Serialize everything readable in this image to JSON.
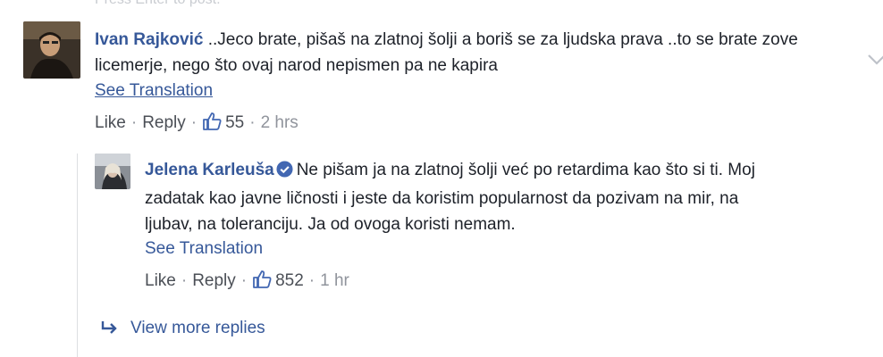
{
  "top_hint": "Press Enter to post.",
  "comments": [
    {
      "author": "Ivan Rajković",
      "text": "..Jeco brate, pišaš na zlatnoj šolji a boriš se za ljudska prava ..to se brate zove licemerje, nego što ovaj narod nepismen pa ne kapira",
      "see_translation": "See Translation",
      "like_label": "Like",
      "reply_label": "Reply",
      "like_count": "55",
      "time": "2 hrs"
    },
    {
      "author": "Jelena Karleuša",
      "verified": true,
      "text": "Ne pišam ja na zlatnoj šolji već po retardima kao što si ti. Moj zadatak kao javne ličnosti i jeste da koristim popularnost da pozivam na mir, na ljubav, na toleranciju. Ja od ovoga koristi nemam.",
      "see_translation": "See Translation",
      "like_label": "Like",
      "reply_label": "Reply",
      "like_count": "852",
      "time": "1 hr"
    }
  ],
  "view_more_replies": "View more replies",
  "colors": {
    "link": "#365899",
    "text": "#1d2129",
    "meta": "#90949c",
    "verified": "#4267b2"
  },
  "icons": [
    "chevron-down-icon",
    "thumbs-up-icon",
    "verified-badge-icon",
    "reply-arrow-icon"
  ]
}
